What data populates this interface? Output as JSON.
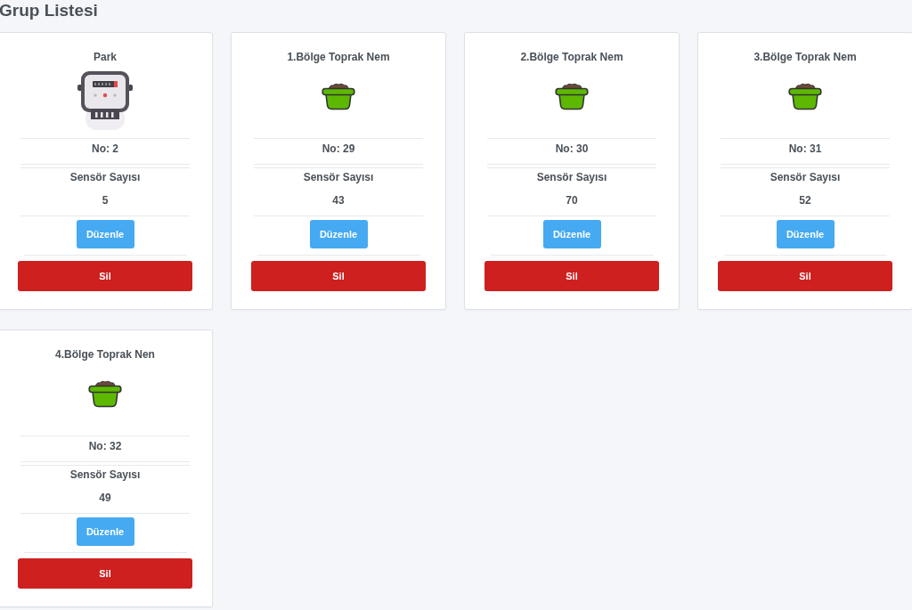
{
  "page": {
    "title": "Grup Listesi"
  },
  "groups": [
    {
      "name": "Park",
      "kind": "meter",
      "number": "No: 2",
      "sensor_label": "Sensör Sayısı",
      "sensor_count": "5",
      "edit_button": "Düzenle",
      "delete_button": "Sil"
    },
    {
      "name": "1.Bölge Toprak Nem",
      "kind": "pot",
      "number": "No: 29",
      "sensor_label": "Sensör Sayısı",
      "sensor_count": "43",
      "edit_button": "Düzenle",
      "delete_button": "Sil"
    },
    {
      "name": "2.Bölge Toprak Nem",
      "kind": "pot",
      "number": "No: 30",
      "sensor_label": "Sensör Sayısı",
      "sensor_count": "70",
      "edit_button": "Düzenle",
      "delete_button": "Sil"
    },
    {
      "name": "3.Bölge Toprak Nem",
      "kind": "pot",
      "number": "No: 31",
      "sensor_label": "Sensör Sayısı",
      "sensor_count": "52",
      "edit_button": "Düzenle",
      "delete_button": "Sil"
    },
    {
      "name": "4.Bölge Toprak Nen",
      "kind": "pot",
      "number": "No: 32",
      "sensor_label": "Sensör Sayısı",
      "sensor_count": "49",
      "edit_button": "Düzenle",
      "delete_button": "Sil"
    }
  ]
}
